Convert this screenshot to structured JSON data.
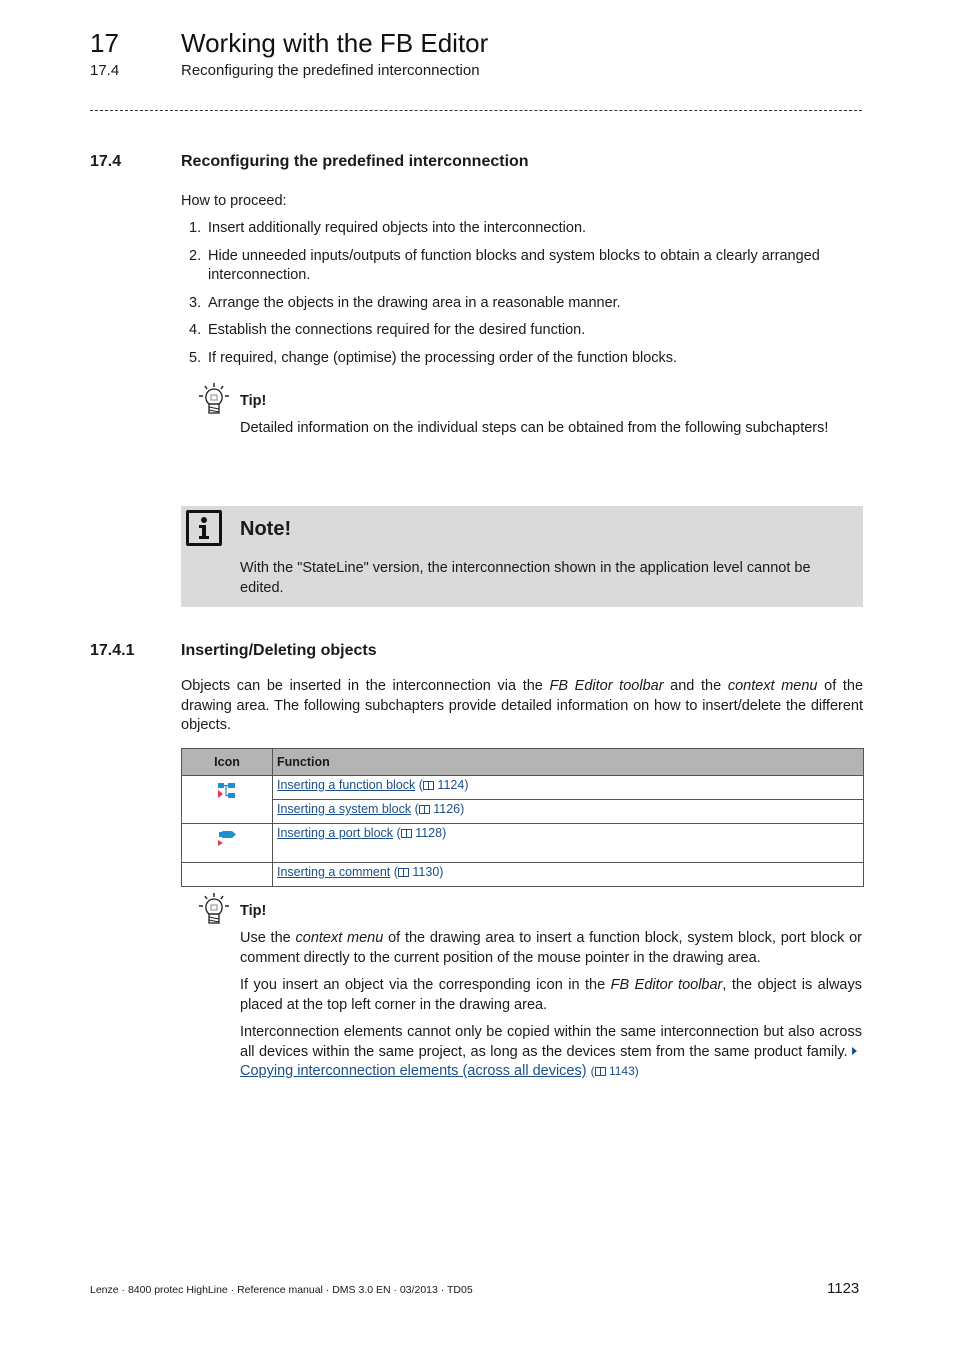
{
  "header": {
    "chapter_number": "17",
    "chapter_title": "Working with the FB Editor",
    "section_number": "17.4",
    "section_title": "Reconfiguring the predefined interconnection"
  },
  "section": {
    "number": "17.4",
    "title": "Reconfiguring the predefined interconnection",
    "lead": "How to proceed:",
    "steps": [
      {
        "n": "1.",
        "text": "Insert additionally required objects into the interconnection."
      },
      {
        "n": "2.",
        "text": "Hide unneeded inputs/outputs of function blocks and system blocks to obtain a clearly arranged interconnection."
      },
      {
        "n": "3.",
        "text": "Arrange the objects in the drawing area in a reasonable manner."
      },
      {
        "n": "4.",
        "text": "Establish the connections required for the desired function."
      },
      {
        "n": "5.",
        "text": "If required, change (optimise) the processing order of the function blocks."
      }
    ],
    "tip": {
      "icon": "lightbulb-icon",
      "label": "Tip!",
      "text": "Detailed information on the individual steps can be obtained from the following subchapters!"
    },
    "note": {
      "icon": "info-icon",
      "label": "Note!",
      "text": "With the \"StateLine\" version, the interconnection shown in the application level cannot be edited."
    }
  },
  "subsection": {
    "number": "17.4.1",
    "title": "Inserting/Deleting objects",
    "intro_parts": {
      "a": "Objects can be inserted in the interconnection via the ",
      "b": "FB Editor toolbar",
      "c": " and the ",
      "d": "context menu",
      "e": " of the drawing area. The following subchapters provide detailed information on how to insert/delete the different objects."
    },
    "table": {
      "headers": [
        "Icon",
        "Function"
      ],
      "rows": [
        {
          "icon": "function-block-icon",
          "link": "Inserting a function block",
          "page": "1124"
        },
        {
          "icon": "",
          "link": "Inserting a system block",
          "page": "1126"
        },
        {
          "icon": "port-block-icon",
          "link": "Inserting a port block",
          "page": "1128"
        },
        {
          "icon": "",
          "link": "Inserting a comment",
          "page": "1130"
        }
      ]
    },
    "tip": {
      "label": "Tip!",
      "p1": {
        "a": "Use the ",
        "b": "context menu",
        "c": " of the drawing area to insert a function block, system block, port block or comment directly to the current position of the mouse pointer in the drawing area."
      },
      "p2": {
        "a": "If you insert an object via the corresponding icon in the ",
        "b": "FB Editor toolbar",
        "c": ", the object is always placed at the top left corner in the drawing area."
      },
      "p3": {
        "a": "Interconnection elements cannot only be copied within the same interconnection but also across all devices within the same project, as long as the devices stem from the same product family. ",
        "link": "Copying interconnection elements (across all devices)",
        "page": "1143"
      }
    }
  },
  "footer": {
    "text": "Lenze · 8400 protec HighLine · Reference manual · DMS 3.0 EN · 03/2013 · TD05",
    "page": "1123"
  },
  "colors": {
    "link": "#1a4f8a",
    "note_bg": "#dadada",
    "table_header_bg": "#b4b4b4",
    "icon_blue": "#1e90d0",
    "icon_red": "#e8384f"
  }
}
